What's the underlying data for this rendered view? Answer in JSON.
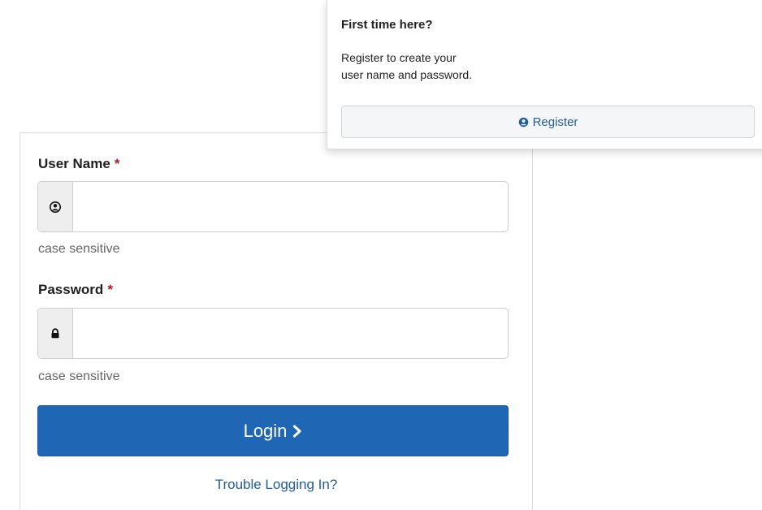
{
  "login": {
    "username": {
      "label": "User Name",
      "required_marker": "*",
      "value": "",
      "help": "case sensitive",
      "icon": "user-circle-icon"
    },
    "password": {
      "label": "Password",
      "required_marker": "*",
      "value": "",
      "help": "case sensitive",
      "icon": "lock-icon"
    },
    "login_button": {
      "label": "Login",
      "icon": "chevron-right-icon"
    },
    "trouble_link": "Trouble Logging In?"
  },
  "register": {
    "title": "First time here?",
    "description_line1": "Register to create your",
    "description_line2": "user name and password.",
    "button_label": "Register",
    "button_icon": "user-circle-icon"
  },
  "colors": {
    "primary": "#1f66b4",
    "link": "#1f5c99",
    "required": "#b0192c",
    "addon_bg": "#eeeeee"
  }
}
